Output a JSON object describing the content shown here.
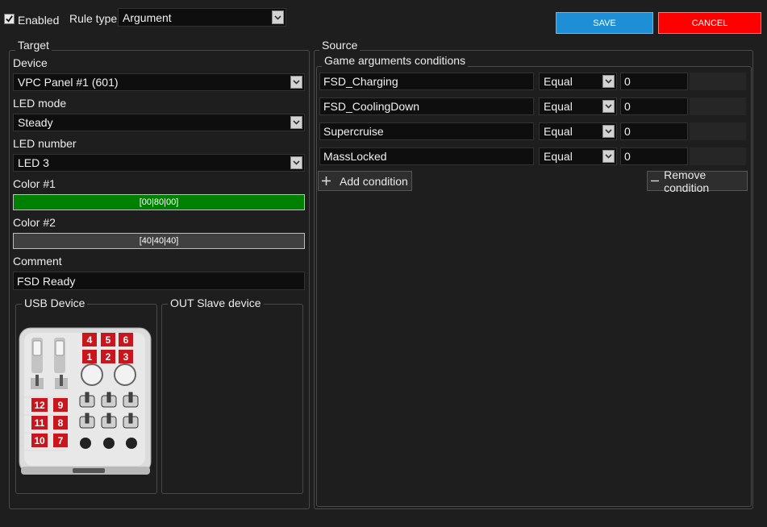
{
  "header": {
    "enabled_label": "Enabled",
    "enabled_checked": true,
    "rule_type_label": "Rule type",
    "rule_type_value": "Argument",
    "save_label": "SAVE",
    "cancel_label": "CANCEL"
  },
  "target": {
    "title": "Target",
    "device_label": "Device",
    "device_value": "VPC Panel #1 (601)",
    "led_mode_label": "LED mode",
    "led_mode_value": "Steady",
    "led_number_label": "LED number",
    "led_number_value": "LED 3",
    "color1_label": "Color #1",
    "color1_value": "[00|80|00]",
    "color2_label": "Color #2",
    "color2_value": "[40|40|40]",
    "comment_label": "Comment",
    "comment_value": "FSD Ready",
    "usb_device_title": "USB Device",
    "out_slave_title": "OUT Slave device",
    "panel_keys": [
      "4",
      "5",
      "6",
      "1",
      "2",
      "3",
      "12",
      "9",
      "11",
      "8",
      "10",
      "7"
    ]
  },
  "source": {
    "title": "Source",
    "conditions_title": "Game arguments conditions",
    "conditions": [
      {
        "name": "FSD_Charging",
        "operator": "Equal",
        "value": "0"
      },
      {
        "name": "FSD_CoolingDown",
        "operator": "Equal",
        "value": "0"
      },
      {
        "name": "Supercruise",
        "operator": "Equal",
        "value": "0"
      },
      {
        "name": "MassLocked",
        "operator": "Equal",
        "value": "0"
      }
    ],
    "add_condition_label": "Add condition",
    "remove_condition_label": "Remove condition"
  },
  "colors": {
    "save_bg": "#1e8fd6",
    "cancel_bg": "#ff0000",
    "color1_bg": "#008000",
    "color2_bg": "#404040",
    "key_red": "#c8161c"
  }
}
